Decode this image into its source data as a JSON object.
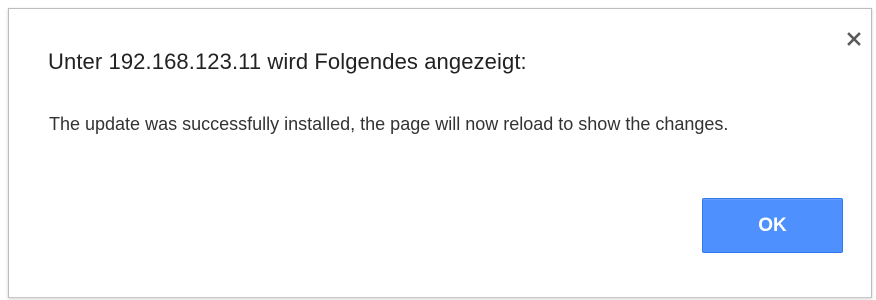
{
  "dialog": {
    "title": "Unter 192.168.123.11 wird Folgendes angezeigt:",
    "message": "The update was successfully installed, the page will now reload to show the changes.",
    "ok_label": "OK",
    "close_icon": "close-icon"
  },
  "colors": {
    "button_bg": "#4d90fe",
    "button_border": "#3079ed",
    "title_text": "#222222",
    "body_text": "#333333"
  }
}
